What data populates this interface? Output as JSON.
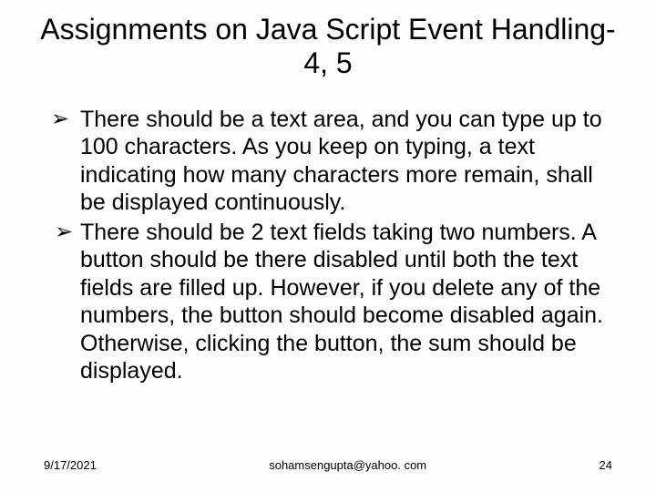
{
  "title": "Assignments on Java Script Event Handling-4, 5",
  "bullets": [
    " There should be a text area, and you can type up to 100 characters. As you keep on typing, a text indicating how many characters more remain, shall be displayed continuously.",
    "There should be 2 text fields taking two numbers. A button should be there disabled until both the text fields are filled up. However, if you delete any of the numbers, the button should become disabled again. Otherwise, clicking the button, the sum should be displayed."
  ],
  "footer": {
    "date": "9/17/2021",
    "email": "sohamsengupta@yahoo. com",
    "page": "24"
  },
  "marker": "➢"
}
